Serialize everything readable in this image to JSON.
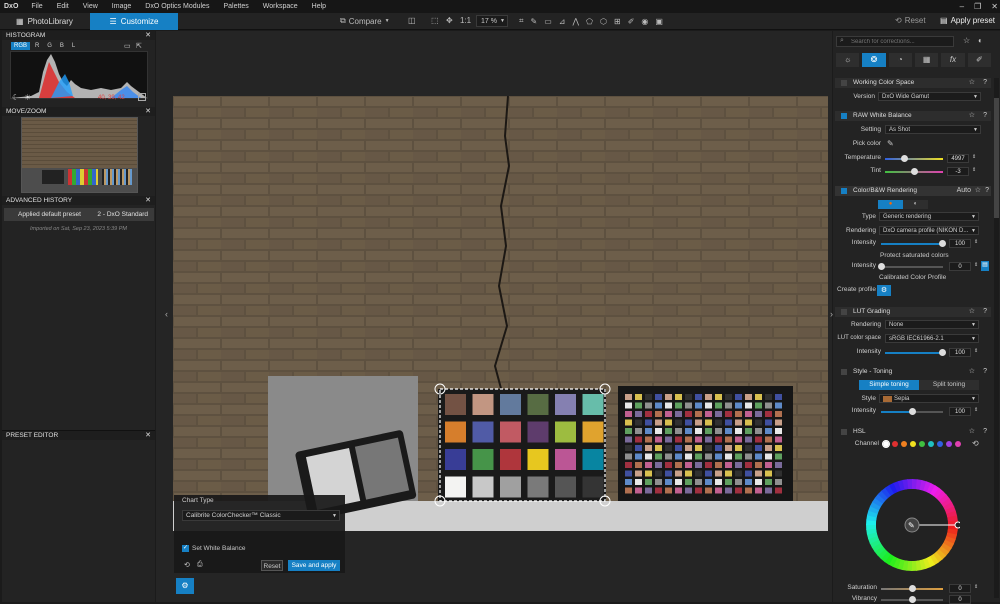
{
  "menubar": {
    "logo": "DxO",
    "items": [
      "File",
      "Edit",
      "View",
      "Image",
      "DxO Optics Modules",
      "Palettes",
      "Workspace",
      "Help"
    ]
  },
  "toolbar": {
    "tab_photolibrary": "PhotoLibrary",
    "tab_customize": "Customize",
    "compare": "Compare",
    "ratio": "1:1",
    "zoom": "17 %",
    "reset": "Reset",
    "apply_preset": "Apply preset"
  },
  "left": {
    "histogram_title": "HISTOGRAM",
    "histo_tabs": [
      "RGB",
      "R",
      "G",
      "B",
      "L"
    ],
    "histo_values": "40, 39, 42",
    "movezoom_title": "MOVE/ZOOM",
    "history_title": "ADVANCED HISTORY",
    "history_item_label": "Applied default preset",
    "history_item_value": "2 - DxO Standard",
    "history_note": "Imported on Sat, Sep 23, 2023 5:39 PM",
    "preset_editor_title": "PRESET EDITOR"
  },
  "chart_box": {
    "title": "Chart Type",
    "selected": "Calibrite ColorChecker™ Classic",
    "set_wb": "Set White Balance",
    "reset": "Reset",
    "save_apply": "Save and apply"
  },
  "right": {
    "search_placeholder": "Search for corrections...",
    "working_color_space": "Working Color Space",
    "version_label": "Version",
    "version_value": "DxO Wide Gamut",
    "raw_wb": "RAW White Balance",
    "setting_label": "Setting",
    "setting_value": "As Shot",
    "pick_color": "Pick color",
    "temperature_label": "Temperature",
    "temperature_value": "4997",
    "tint_label": "Tint",
    "tint_value": "-3",
    "color_bw": "Color/B&W Rendering",
    "auto": "Auto",
    "type_label": "Type",
    "type_value": "Generic rendering",
    "rendering_label": "Rendering",
    "rendering_value": "DxO camera profile (NIKON D...",
    "intensity_label": "Intensity",
    "intensity_value": "100",
    "protect_sat": "Protect saturated colors",
    "protect_value": "0",
    "calibrated_profile": "Calibrated Color Profile",
    "create_profile": "Create profile",
    "lut_grading": "LUT Grading",
    "lut_rendering_label": "Rendering",
    "lut_rendering_value": "None",
    "lut_cs_label": "LUT color space",
    "lut_cs_value": "sRGB IEC61966-2.1",
    "lut_intensity_value": "100",
    "style_toning": "Style - Toning",
    "simple_toning": "Simple toning",
    "split_toning": "Split toning",
    "style_label": "Style",
    "style_value": "Sepia",
    "style_intensity_value": "100",
    "hsl": "HSL",
    "channel_label": "Channel",
    "saturation_label": "Saturation",
    "saturation_value": "0",
    "vibrancy_label": "Vibrancy",
    "vibrancy_value": "0"
  },
  "colors": {
    "accent": "#1680c4",
    "channels": [
      "#ffffff",
      "#e03030",
      "#f08020",
      "#f0e020",
      "#40c040",
      "#20c0c0",
      "#3060e0",
      "#a040e0",
      "#e040b0"
    ]
  }
}
